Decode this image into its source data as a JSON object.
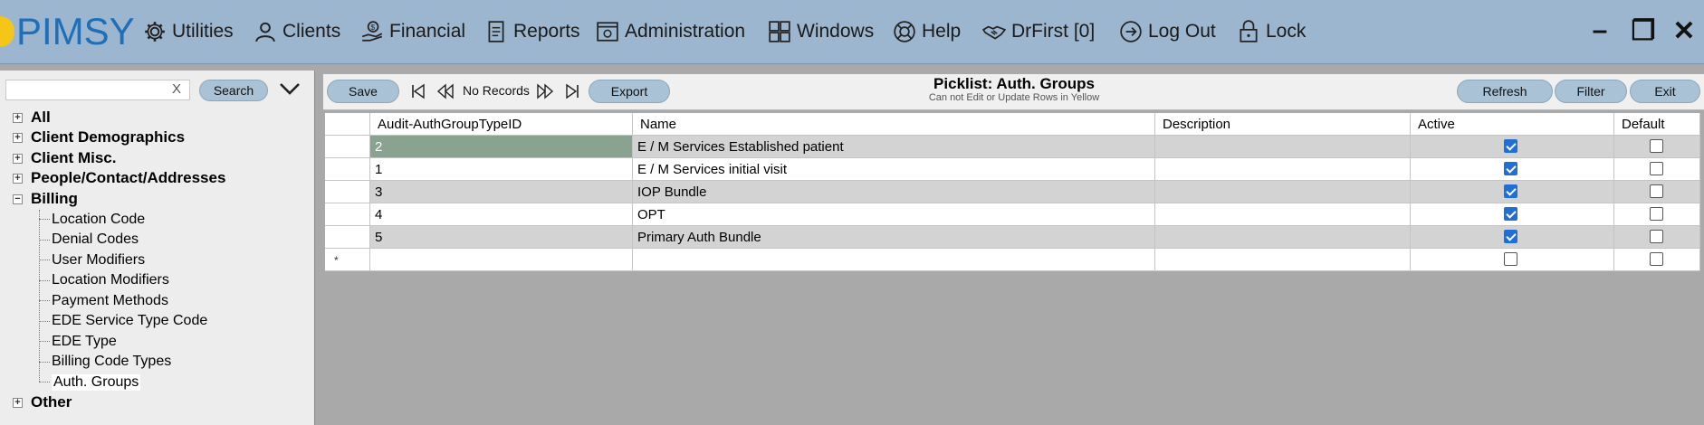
{
  "app": {
    "logo_text": "PIMSY"
  },
  "menu": {
    "items": [
      {
        "label": "Utilities",
        "icon": "gear-icon"
      },
      {
        "label": "Clients",
        "icon": "person-icon"
      },
      {
        "label": "Financial",
        "icon": "money-hand-icon"
      },
      {
        "label": "Reports",
        "icon": "report-icon"
      },
      {
        "label": "Administration",
        "icon": "admin-window-icon"
      },
      {
        "label": "Windows",
        "icon": "windows-grid-icon"
      },
      {
        "label": "Help",
        "icon": "lifebuoy-icon"
      },
      {
        "label": "DrFirst [0]",
        "icon": "handshake-icon"
      },
      {
        "label": "Log Out",
        "icon": "logout-icon"
      },
      {
        "label": "Lock",
        "icon": "lock-icon"
      }
    ],
    "window_controls": {
      "minimize": "–",
      "restore": "❐",
      "close": "✕"
    }
  },
  "sidebar": {
    "search": {
      "value": "",
      "clear_label": "X",
      "button_label": "Search"
    },
    "tree": {
      "top_nodes": [
        {
          "label": "All",
          "expander": "+"
        },
        {
          "label": "Client Demographics",
          "expander": "+"
        },
        {
          "label": "Client Misc.",
          "expander": "+"
        },
        {
          "label": "People/Contact/Addresses",
          "expander": "+"
        },
        {
          "label": "Billing",
          "expander": "−"
        }
      ],
      "billing_children": [
        "Location Code",
        "Denial Codes",
        "User Modifiers",
        "Location Modifiers",
        "Payment Methods",
        "EDE Service Type Code",
        "EDE Type",
        "Billing Code Types",
        "Auth. Groups"
      ],
      "selected": "Auth. Groups",
      "other": {
        "label": "Other",
        "expander": "+"
      }
    }
  },
  "toolbar": {
    "save_label": "Save",
    "no_records": "No Records",
    "export_label": "Export",
    "refresh_label": "Refresh",
    "filter_label": "Filter",
    "exit_label": "Exit"
  },
  "picklist": {
    "title": "Picklist: Auth. Groups",
    "subtitle": "Can not Edit or Update Rows in Yellow"
  },
  "grid": {
    "columns": [
      "Audit-AuthGroupTypeID",
      "Name",
      "Description",
      "Active",
      "Default"
    ],
    "rows": [
      {
        "id": "2",
        "name": "E / M Services Established patient",
        "description": "",
        "active": true,
        "default": false
      },
      {
        "id": "1",
        "name": "E / M Services initial visit",
        "description": "",
        "active": true,
        "default": false
      },
      {
        "id": "3",
        "name": "IOP Bundle",
        "description": "",
        "active": true,
        "default": false
      },
      {
        "id": "4",
        "name": "OPT",
        "description": "",
        "active": true,
        "default": false
      },
      {
        "id": "5",
        "name": "Primary Auth Bundle",
        "description": "",
        "active": true,
        "default": false
      }
    ],
    "new_row_marker": "*",
    "new_row": {
      "active": false,
      "default": false
    }
  },
  "colors": {
    "menubar": "#9db6cf",
    "pill": "#a9c2d6",
    "selected_cell": "#8aa391",
    "alt_row": "#d3d3d3",
    "checkbox_checked": "#1f6fd6"
  }
}
